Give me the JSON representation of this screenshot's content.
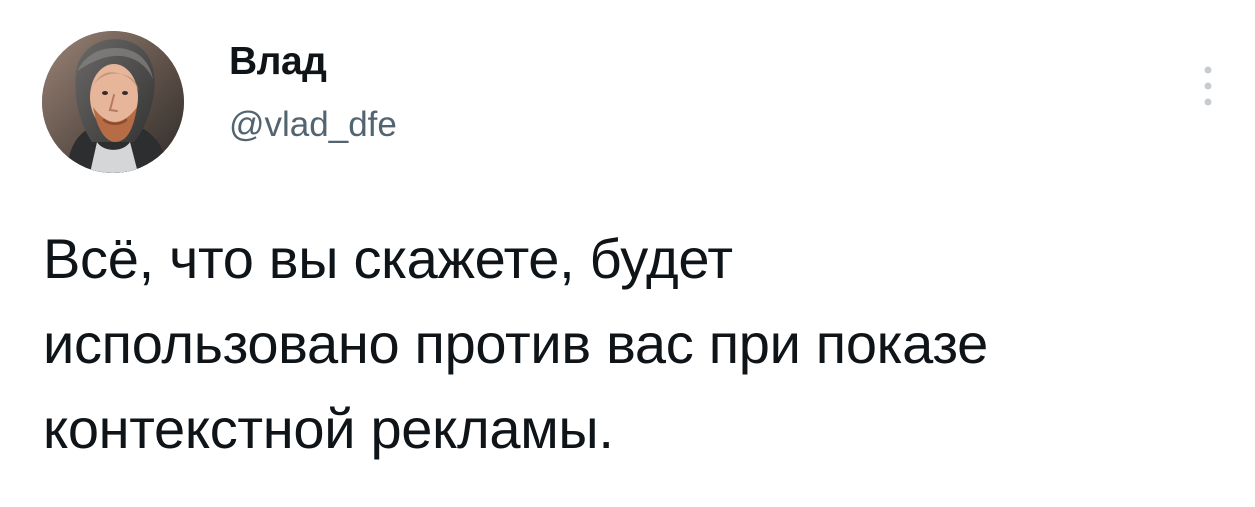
{
  "author": {
    "display_name": "Влад",
    "handle": "@vlad_dfe",
    "avatar_icon": "avatar-image"
  },
  "tweet": {
    "lines": [
      "Всё, что вы скажете, будет",
      "использовано против вас при показе",
      "контекстной рекламы."
    ]
  },
  "menu": {
    "icon": "more-vertical-icon"
  },
  "colors": {
    "text": "#0f1419",
    "secondary_text": "#536471",
    "background": "#ffffff",
    "menu_icon": "#c7ccd1"
  }
}
